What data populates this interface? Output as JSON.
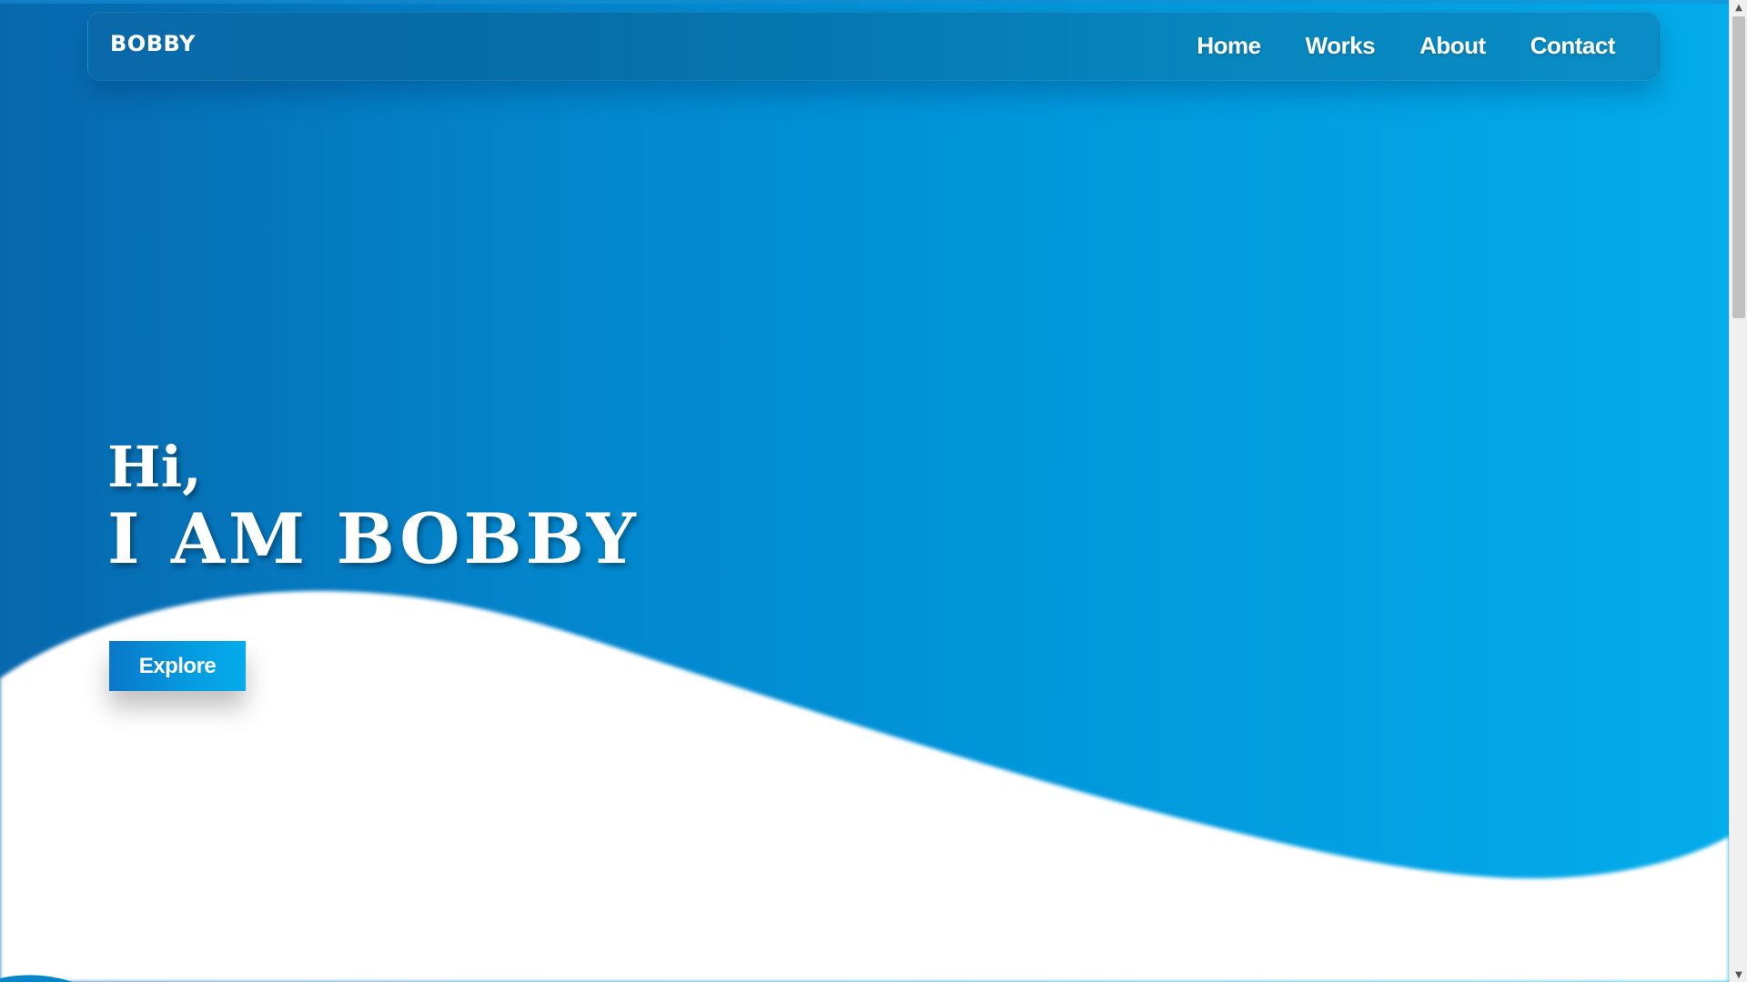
{
  "nav": {
    "brand": "BOBBY",
    "links": [
      {
        "label": "Home"
      },
      {
        "label": "Works"
      },
      {
        "label": "About"
      },
      {
        "label": "Contact"
      }
    ]
  },
  "hero": {
    "greeting": "Hi,",
    "name": "I AM BOBBY",
    "cta_label": "Explore"
  },
  "scrollbar": {
    "up_icon": "scroll-up-arrow-icon",
    "down_icon": "scroll-down-arrow-icon"
  },
  "colors": {
    "hero_gradient_start": "#0768ad",
    "hero_gradient_end": "#04aceb",
    "wave": "#ffffff",
    "text": "#ffffff"
  }
}
